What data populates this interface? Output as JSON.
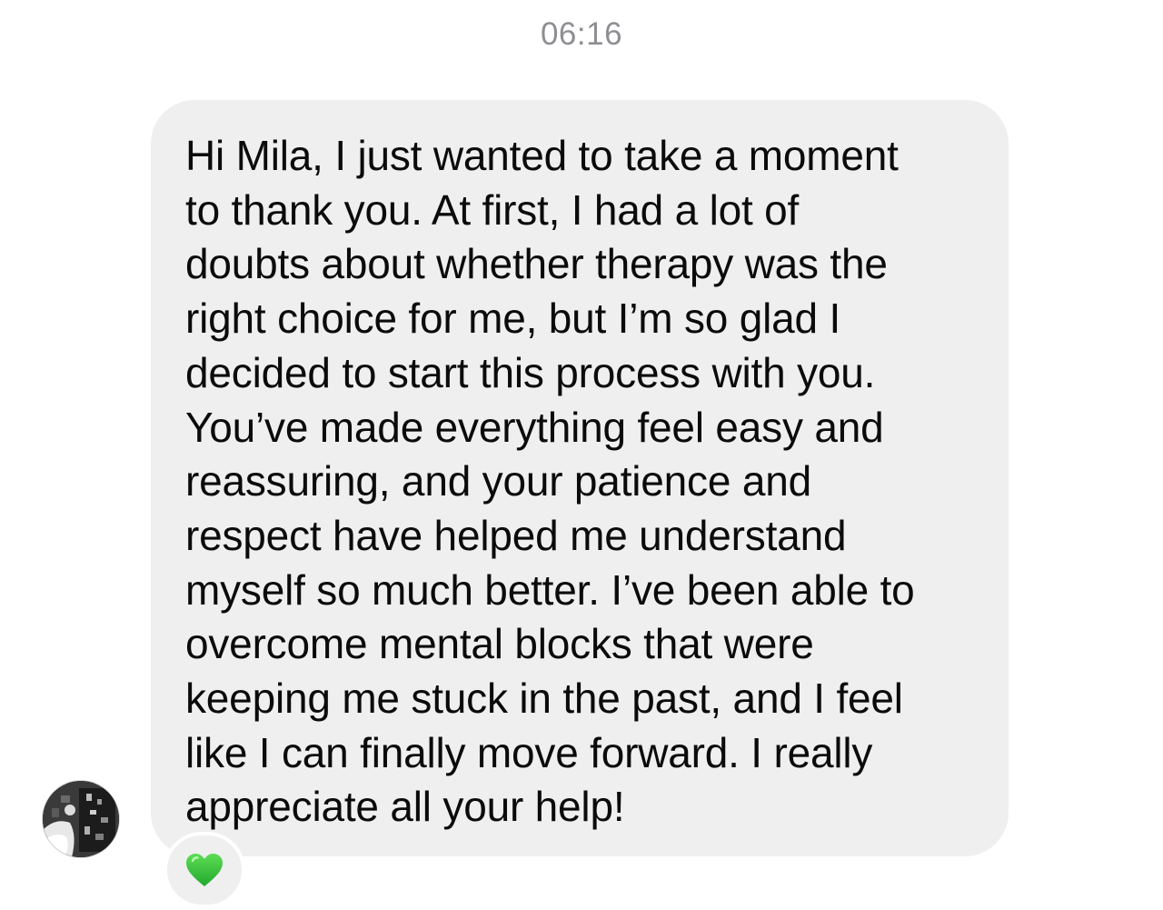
{
  "conversation": {
    "timestamp": "06:16"
  },
  "message": {
    "lines": [
      "Hi Mila, I just wanted to take a moment",
      "to thank you. At first, I had a lot of",
      "doubts about whether therapy was the",
      "right choice for me, but I’m so glad I",
      "decided to start this process with you.",
      "You’ve made everything feel easy and",
      "reassuring, and your patience and",
      "respect have helped me understand",
      "myself so much better. I’ve been able to",
      "overcome mental blocks that were",
      "keeping me stuck in the past, and I feel",
      "like I can finally move forward. I really",
      "appreciate all your help!"
    ],
    "reaction_icon": "green-heart-icon",
    "reaction_color": "#2fbf3a",
    "bubble_color": "#efeff0"
  },
  "sender": {
    "avatar_icon": "user-avatar"
  }
}
